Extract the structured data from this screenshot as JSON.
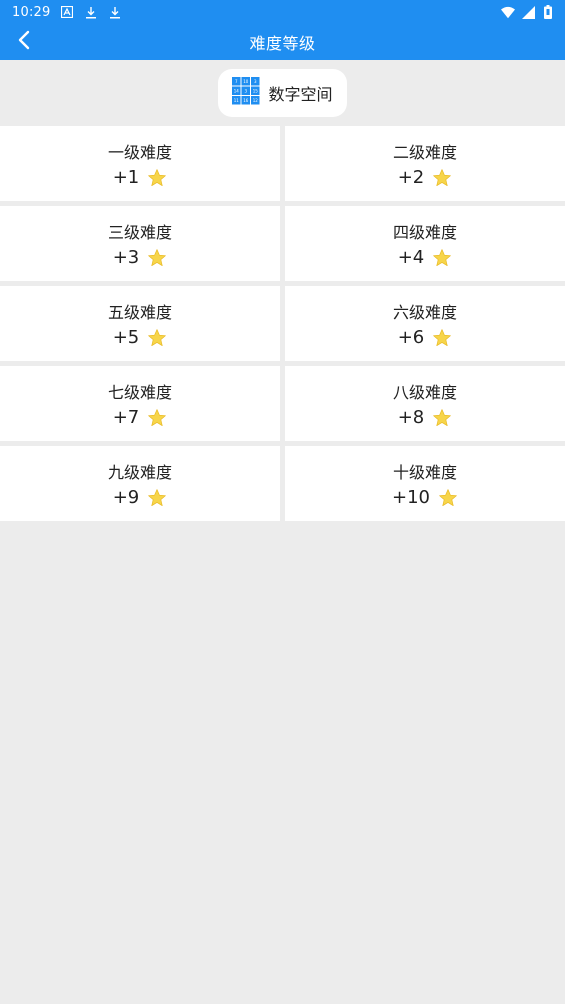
{
  "status_bar": {
    "time": "10:29",
    "icons": [
      "a-box-icon",
      "download-icon",
      "download-icon"
    ],
    "right_icons": [
      "wifi-icon",
      "cell-signal-icon",
      "battery-icon"
    ]
  },
  "app_bar": {
    "title": "难度等级",
    "back_icon": "chevron-left-icon"
  },
  "category_chip": {
    "icon": "number-grid-icon",
    "label": "数字空间",
    "grid_numbers": [
      "7",
      "10",
      "3",
      "14",
      "3",
      "15",
      "11",
      "16",
      "12"
    ]
  },
  "levels": [
    {
      "title": "一级难度",
      "reward": "+1"
    },
    {
      "title": "二级难度",
      "reward": "+2"
    },
    {
      "title": "三级难度",
      "reward": "+3"
    },
    {
      "title": "四级难度",
      "reward": "+4"
    },
    {
      "title": "五级难度",
      "reward": "+5"
    },
    {
      "title": "六级难度",
      "reward": "+6"
    },
    {
      "title": "七级难度",
      "reward": "+7"
    },
    {
      "title": "八级难度",
      "reward": "+8"
    },
    {
      "title": "九级难度",
      "reward": "+9"
    },
    {
      "title": "十级难度",
      "reward": "+10"
    }
  ],
  "colors": {
    "primary": "#1f8ef1",
    "background": "#ececec",
    "star": "#f7d54a"
  }
}
